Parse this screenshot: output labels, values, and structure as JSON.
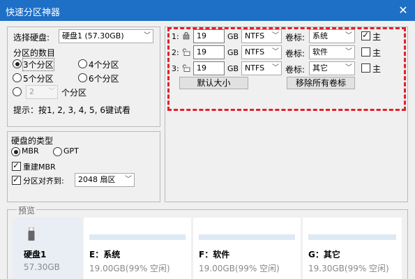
{
  "window": {
    "title": "快速分区神器",
    "close_glyph": "✕"
  },
  "disk_select": {
    "label": "选择硬盘:",
    "value": "硬盘1 (57.30GB)"
  },
  "partition_count": {
    "heading": "分区的数目",
    "options": [
      "3个分区",
      "4个分区",
      "5个分区",
      "6个分区"
    ],
    "custom_value": "2",
    "custom_suffix": "个分区",
    "hint": "提示：按1, 2, 3, 4, 5, 6键试看"
  },
  "disk_type": {
    "heading": "硬盘的类型",
    "mbr": "MBR",
    "gpt": "GPT",
    "rebuild_mbr": "重建MBR",
    "align_label": "分区对齐到:",
    "align_value": "2048 扇区"
  },
  "partitions": {
    "unit": "GB",
    "volume_label_caption": "卷标:",
    "primary_caption": "主",
    "rows": [
      {
        "index": "1:",
        "size": "19",
        "fs": "NTFS",
        "label": "系统",
        "primary": true
      },
      {
        "index": "2:",
        "size": "19",
        "fs": "NTFS",
        "label": "软件",
        "primary": false
      },
      {
        "index": "3:",
        "size": "19",
        "fs": "NTFS",
        "label": "其它",
        "primary": false
      }
    ],
    "default_size_button": "默认大小",
    "remove_labels_button": "移除所有卷标"
  },
  "preview": {
    "heading": "预览",
    "disk_name": "硬盘1",
    "disk_size": "57.30GB",
    "cards": [
      {
        "title": "E：系统",
        "detail": "19.00GB(99% 空闲)"
      },
      {
        "title": "F：软件",
        "detail": "19.00GB(99% 空闲)"
      },
      {
        "title": "G：其它",
        "detail": "19.30GB(99% 空闲)"
      }
    ]
  },
  "colors": {
    "titlebar": "#1e6fc6",
    "highlight": "#e0202c",
    "card_bar": "#dde9f5"
  }
}
